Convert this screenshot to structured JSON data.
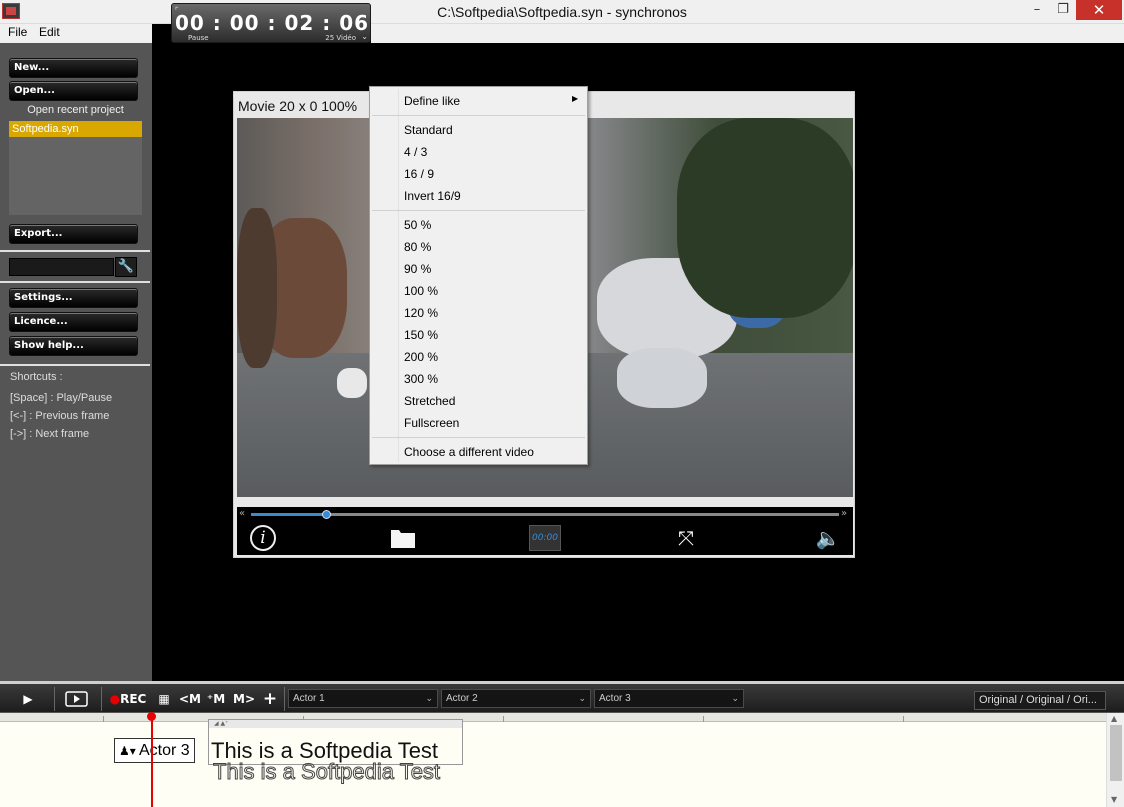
{
  "window": {
    "title": "C:\\Softpedia\\Softpedia.syn - synchronos",
    "minimize": "–",
    "maximize": "❐",
    "close": "✕"
  },
  "timecode": {
    "value": "00 : 00 : 02 : 06",
    "state": "Pause",
    "fps": "25 Vidéo"
  },
  "menu": {
    "file": "File",
    "edit": "Edit"
  },
  "sidebar": {
    "new": "New...",
    "open": "Open...",
    "open_recent_title": "Open recent project",
    "recent_items": [
      "Softpedia.syn"
    ],
    "export": "Export...",
    "settings": "Settings...",
    "licence": "Licence...",
    "show_help": "Show help...",
    "shortcuts_title": "Shortcuts :",
    "shortcuts": [
      "[Space] : Play/Pause",
      "[<-] : Previous frame",
      "[->] : Next frame"
    ]
  },
  "video": {
    "label": "Movie 20 x 0 100%",
    "progress": 0.13,
    "counter": "00:00"
  },
  "context_menu": {
    "define_like": "Define like",
    "ratios": [
      "Standard",
      "4 / 3",
      "16 / 9",
      "Invert 16/9"
    ],
    "zooms": [
      "50 %",
      "80 %",
      "90 %",
      "100 %",
      "120 %",
      "150 %",
      "200 %",
      "300 %",
      "Stretched",
      "Fullscreen"
    ],
    "choose_video": "Choose a different video"
  },
  "toolbar": {
    "rec": "REC",
    "actors": [
      "Actor 1",
      "Actor 2",
      "Actor 3"
    ],
    "original": "Original / Original / Ori..."
  },
  "timeline": {
    "actor_tag": "Actor 3",
    "line_text": "This is a Softpedia Test"
  },
  "colors": {
    "accent": "#3c8bd0",
    "recent_highlight": "#d8a800",
    "playhead": "#e60000",
    "close": "#c7312a"
  }
}
